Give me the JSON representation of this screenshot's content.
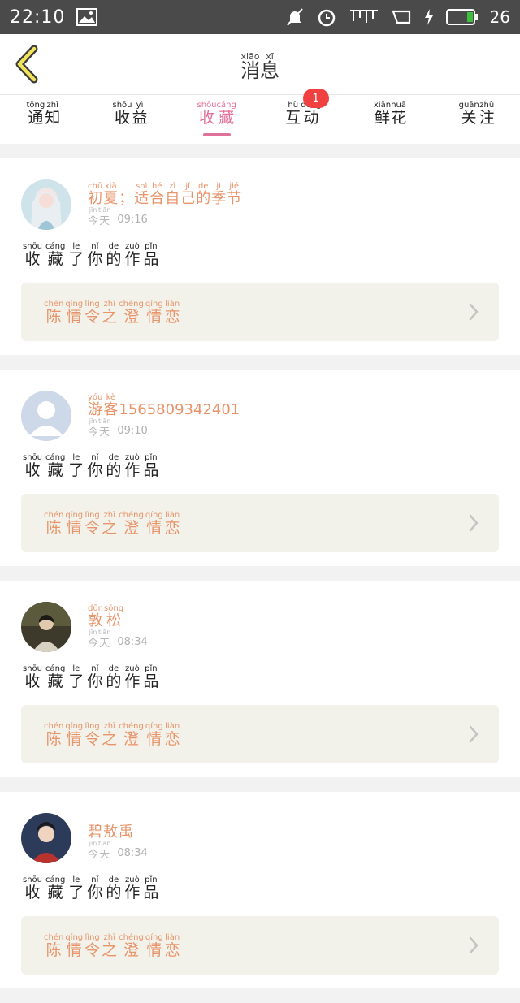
{
  "status_bar": {
    "time": "22:10",
    "battery_percent": "26",
    "icons": [
      "image-icon",
      "bell-muted-icon",
      "alarm-icon",
      "signal-icon",
      "screen-rotate-icon",
      "charging-icon",
      "battery-icon"
    ]
  },
  "header": {
    "title": [
      {
        "py": "xiāo",
        "ch": "消"
      },
      {
        "py": "xī",
        "ch": "息"
      }
    ]
  },
  "tabs": [
    {
      "label": [
        {
          "py": "tōng",
          "ch": "通"
        },
        {
          "py": "zhī",
          "ch": "知"
        }
      ]
    },
    {
      "label": [
        {
          "py": "shōu",
          "ch": "收"
        },
        {
          "py": "yì",
          "ch": "益"
        }
      ]
    },
    {
      "label": [
        {
          "py": "shōu",
          "ch": "收"
        },
        {
          "py": "cáng",
          "ch": "藏"
        }
      ],
      "active": true
    },
    {
      "label": [
        {
          "py": "hù",
          "ch": "互"
        },
        {
          "py": "dòng",
          "ch": "动"
        }
      ],
      "badge": "1"
    },
    {
      "label": [
        {
          "py": "xiān",
          "ch": "鲜"
        },
        {
          "py": "huā",
          "ch": "花"
        }
      ]
    },
    {
      "label": [
        {
          "py": "guān",
          "ch": "关"
        },
        {
          "py": "zhù",
          "ch": "注"
        }
      ]
    }
  ],
  "colors": {
    "accent": "#e0719a",
    "name": "#e8946a",
    "badge": "#f04040"
  },
  "day_label": [
    {
      "py": "jīn",
      "ch": "今"
    },
    {
      "py": "tiān",
      "ch": "天"
    }
  ],
  "action_text": [
    {
      "py": "shōu",
      "ch": "收"
    },
    {
      "py": "cáng",
      "ch": "藏"
    },
    {
      "py": "le",
      "ch": "了"
    },
    {
      "py": "nǐ",
      "ch": "你"
    },
    {
      "py": "de",
      "ch": "的"
    },
    {
      "py": "zuò",
      "ch": "作"
    },
    {
      "py": "pǐn",
      "ch": "品"
    }
  ],
  "work_title": [
    {
      "py": "chén",
      "ch": "陈"
    },
    {
      "py": "qíng",
      "ch": "情"
    },
    {
      "py": "lìng",
      "ch": "令"
    },
    {
      "py": "zhī",
      "ch": "之"
    },
    {
      "py": "chéng",
      "ch": "澄"
    },
    {
      "py": "qíng",
      "ch": "情"
    },
    {
      "py": "liàn",
      "ch": "恋"
    }
  ],
  "messages": [
    {
      "avatar": "avatar-anime-girl",
      "name": [
        {
          "py": "chū",
          "ch": "初"
        },
        {
          "py": "xià",
          "ch": "夏"
        },
        {
          "py": "",
          "ch": "；"
        },
        {
          "py": "shì",
          "ch": "适"
        },
        {
          "py": "hé",
          "ch": "合"
        },
        {
          "py": "zì",
          "ch": "自"
        },
        {
          "py": "jǐ",
          "ch": "己"
        },
        {
          "py": "de",
          "ch": "的"
        },
        {
          "py": "jì",
          "ch": "季"
        },
        {
          "py": "jié",
          "ch": "节"
        }
      ],
      "time": "09:16"
    },
    {
      "avatar": "avatar-default-user",
      "name": [
        {
          "py": "yóu",
          "ch": "游"
        },
        {
          "py": "kè",
          "ch": "客"
        },
        {
          "py": "",
          "ch": "1565809342401"
        }
      ],
      "time": "09:10"
    },
    {
      "avatar": "avatar-photo-person",
      "name": [
        {
          "py": "dūn",
          "ch": "敦"
        },
        {
          "py": "sōng",
          "ch": "松"
        }
      ],
      "time": "08:34"
    },
    {
      "avatar": "avatar-costume-person",
      "name": [
        {
          "py": "",
          "ch": "碧"
        },
        {
          "py": "",
          "ch": "敖"
        },
        {
          "py": "",
          "ch": "禹"
        }
      ],
      "time": "08:34"
    }
  ]
}
